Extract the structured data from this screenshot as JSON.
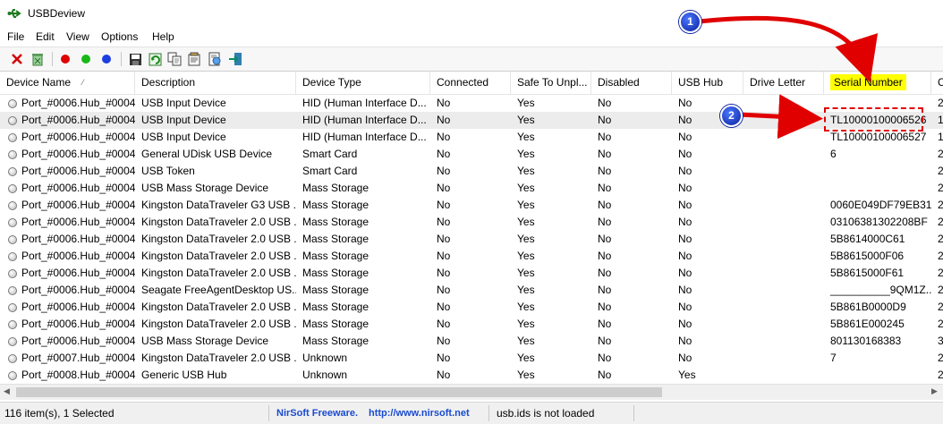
{
  "window": {
    "title": "USBDeview",
    "icon": "usb-icon"
  },
  "menu": [
    "File",
    "Edit",
    "View",
    "Options",
    "Help"
  ],
  "toolbar": [
    {
      "name": "delete-button",
      "icon": "red-x-icon"
    },
    {
      "name": "uninstall-button",
      "icon": "recycle-icon"
    },
    {
      "name": "disconnect-button",
      "icon": "red-dot-icon",
      "color": "#e00000"
    },
    {
      "name": "connect-button",
      "icon": "green-dot-icon",
      "color": "#18b818"
    },
    {
      "name": "refresh-state-button",
      "icon": "blue-dot-icon",
      "color": "#1d3fe0"
    },
    {
      "name": "save-button",
      "icon": "floppy-icon"
    },
    {
      "name": "refresh-button",
      "icon": "refresh-icon"
    },
    {
      "name": "copy-button",
      "icon": "copy-icon"
    },
    {
      "name": "properties-button",
      "icon": "properties-icon"
    },
    {
      "name": "html-report-button",
      "icon": "report-icon"
    },
    {
      "name": "exit-button",
      "icon": "exit-icon"
    }
  ],
  "columns": [
    "Device Name",
    "Description",
    "Device Type",
    "Connected",
    "Safe To Unpl...",
    "Disabled",
    "USB Hub",
    "Drive Letter",
    "Serial Number",
    "C"
  ],
  "rows": [
    {
      "device_name": "Port_#0006.Hub_#0004",
      "description": "USB Input Device",
      "device_type": "HID (Human Interface D...",
      "connected": "No",
      "safe": "Yes",
      "disabled": "No",
      "usb_hub": "No",
      "drive_letter": "",
      "serial": "",
      "extra": "2"
    },
    {
      "device_name": "Port_#0006.Hub_#0004",
      "description": "USB Input Device",
      "device_type": "HID (Human Interface D...",
      "connected": "No",
      "safe": "Yes",
      "disabled": "No",
      "usb_hub": "No",
      "drive_letter": "",
      "serial": "TL10000100006526",
      "extra": "1",
      "selected": true
    },
    {
      "device_name": "Port_#0006.Hub_#0004",
      "description": "USB Input Device",
      "device_type": "HID (Human Interface D...",
      "connected": "No",
      "safe": "Yes",
      "disabled": "No",
      "usb_hub": "No",
      "drive_letter": "",
      "serial": "TL10000100006527",
      "extra": "1"
    },
    {
      "device_name": "Port_#0006.Hub_#0004",
      "description": "General UDisk USB Device",
      "device_type": "Smart Card",
      "connected": "No",
      "safe": "Yes",
      "disabled": "No",
      "usb_hub": "No",
      "drive_letter": "",
      "serial": "6",
      "extra": "2"
    },
    {
      "device_name": "Port_#0006.Hub_#0004",
      "description": "USB Token",
      "device_type": "Smart Card",
      "connected": "No",
      "safe": "Yes",
      "disabled": "No",
      "usb_hub": "No",
      "drive_letter": "",
      "serial": "",
      "extra": "2"
    },
    {
      "device_name": "Port_#0006.Hub_#0004",
      "description": "USB Mass Storage Device",
      "device_type": "Mass Storage",
      "connected": "No",
      "safe": "Yes",
      "disabled": "No",
      "usb_hub": "No",
      "drive_letter": "",
      "serial": "",
      "extra": "2"
    },
    {
      "device_name": "Port_#0006.Hub_#0004",
      "description": "Kingston DataTraveler G3 USB ...",
      "device_type": "Mass Storage",
      "connected": "No",
      "safe": "Yes",
      "disabled": "No",
      "usb_hub": "No",
      "drive_letter": "",
      "serial": "0060E049DF79EB31...",
      "extra": "2"
    },
    {
      "device_name": "Port_#0006.Hub_#0004",
      "description": "Kingston DataTraveler 2.0 USB ...",
      "device_type": "Mass Storage",
      "connected": "No",
      "safe": "Yes",
      "disabled": "No",
      "usb_hub": "No",
      "drive_letter": "",
      "serial": "03106381302208BF",
      "extra": "2"
    },
    {
      "device_name": "Port_#0006.Hub_#0004",
      "description": "Kingston DataTraveler 2.0 USB ...",
      "device_type": "Mass Storage",
      "connected": "No",
      "safe": "Yes",
      "disabled": "No",
      "usb_hub": "No",
      "drive_letter": "",
      "serial": "5B8614000C61",
      "extra": "2"
    },
    {
      "device_name": "Port_#0006.Hub_#0004",
      "description": "Kingston DataTraveler 2.0 USB ...",
      "device_type": "Mass Storage",
      "connected": "No",
      "safe": "Yes",
      "disabled": "No",
      "usb_hub": "No",
      "drive_letter": "",
      "serial": "5B8615000F06",
      "extra": "2"
    },
    {
      "device_name": "Port_#0006.Hub_#0004",
      "description": "Kingston DataTraveler 2.0 USB ...",
      "device_type": "Mass Storage",
      "connected": "No",
      "safe": "Yes",
      "disabled": "No",
      "usb_hub": "No",
      "drive_letter": "",
      "serial": "5B8615000F61",
      "extra": "2"
    },
    {
      "device_name": "Port_#0006.Hub_#0004",
      "description": "Seagate FreeAgentDesktop US...",
      "device_type": "Mass Storage",
      "connected": "No",
      "safe": "Yes",
      "disabled": "No",
      "usb_hub": "No",
      "drive_letter": "",
      "serial": "__________9QM1Z...",
      "extra": "2"
    },
    {
      "device_name": "Port_#0006.Hub_#0004",
      "description": "Kingston DataTraveler 2.0 USB ...",
      "device_type": "Mass Storage",
      "connected": "No",
      "safe": "Yes",
      "disabled": "No",
      "usb_hub": "No",
      "drive_letter": "",
      "serial": "5B861B0000D9",
      "extra": "2"
    },
    {
      "device_name": "Port_#0006.Hub_#0004",
      "description": "Kingston DataTraveler 2.0 USB ...",
      "device_type": "Mass Storage",
      "connected": "No",
      "safe": "Yes",
      "disabled": "No",
      "usb_hub": "No",
      "drive_letter": "",
      "serial": "5B861E000245",
      "extra": "2"
    },
    {
      "device_name": "Port_#0006.Hub_#0004",
      "description": "USB Mass Storage Device",
      "device_type": "Mass Storage",
      "connected": "No",
      "safe": "Yes",
      "disabled": "No",
      "usb_hub": "No",
      "drive_letter": "",
      "serial": "801130168383",
      "extra": "3"
    },
    {
      "device_name": "Port_#0007.Hub_#0004",
      "description": "Kingston DataTraveler 2.0 USB ...",
      "device_type": "Unknown",
      "connected": "No",
      "safe": "Yes",
      "disabled": "No",
      "usb_hub": "No",
      "drive_letter": "",
      "serial": "7",
      "extra": "2"
    },
    {
      "device_name": "Port_#0008.Hub_#0004",
      "description": "Generic USB Hub",
      "device_type": "Unknown",
      "connected": "No",
      "safe": "Yes",
      "disabled": "No",
      "usb_hub": "Yes",
      "drive_letter": "",
      "serial": "",
      "extra": "2"
    }
  ],
  "status": {
    "items": "116 item(s), 1 Selected",
    "nirsoft_label": "NirSoft Freeware.",
    "nirsoft_url": "http://www.nirsoft.net",
    "usbids": "usb.ids is not loaded"
  },
  "annotations": {
    "callout1": "1",
    "callout2": "2",
    "highlight_color": "#ffff00",
    "arrow_color": "#e00000"
  }
}
